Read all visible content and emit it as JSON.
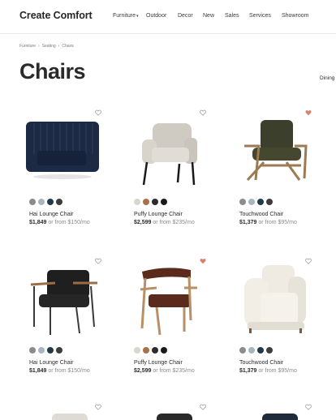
{
  "brand": "Create Comfort",
  "nav": [
    {
      "label": "Furniture",
      "has_caret": true
    },
    {
      "label": "Outdoor"
    },
    {
      "label": "Decor"
    },
    {
      "label": "New"
    },
    {
      "label": "Sales"
    },
    {
      "label": "Services"
    },
    {
      "label": "Showroom"
    }
  ],
  "breadcrumb": [
    "Furniture",
    "Seating",
    "Chairs"
  ],
  "breadcrumb_sep": "›",
  "page_title": "Chairs",
  "filter_tab": "Dining",
  "products": [
    {
      "name": "Hai Lounge Chair",
      "price": "$1,849",
      "financing": "or from $150/mo",
      "favorited": false,
      "swatches": [
        "#8b8b8b",
        "#a9b6bd",
        "#1f3a4a",
        "#3d3d3d"
      ],
      "image": "navy-velvet-swivel-chair-icon"
    },
    {
      "name": "Puffy Lounge Chair",
      "price": "$2,599",
      "financing": "or from $235/mo",
      "favorited": false,
      "swatches": [
        "#d9d6cf",
        "#a9714a",
        "#2c2c2c",
        "#1a1a1a"
      ],
      "image": "gray-boucle-lounge-chair-icon"
    },
    {
      "name": "Touchwood Chair",
      "price": "$1,379",
      "financing": "or from $95/mo",
      "favorited": true,
      "swatches": [
        "#8c8c8c",
        "#a7b5bd",
        "#1f3a4a",
        "#3d3d3d"
      ],
      "image": "olive-leather-wood-chair-icon"
    },
    {
      "name": "Hai Lounge Chair",
      "price": "$1,849",
      "financing": "or from $150/mo",
      "favorited": false,
      "swatches": [
        "#8b8b8b",
        "#a9b6bd",
        "#1f3a4a",
        "#3d3d3d"
      ],
      "image": "black-leather-iron-chair-icon"
    },
    {
      "name": "Puffy Lounge Chair",
      "price": "$2,599",
      "financing": "or from $235/mo",
      "favorited": true,
      "swatches": [
        "#d9d6cf",
        "#a9714a",
        "#2c2c2c",
        "#1a1a1a"
      ],
      "image": "brown-leather-wood-chair-icon"
    },
    {
      "name": "Touchwood Chair",
      "price": "$1,379",
      "financing": "or from $95/mo",
      "favorited": false,
      "swatches": [
        "#8c8c8c",
        "#a7b5bd",
        "#1f3a4a",
        "#3d3d3d"
      ],
      "image": "white-slipcover-chair-icon"
    }
  ],
  "colors": {
    "heart_outline": "#9a9a9a",
    "heart_filled": "#d9826e",
    "accent_text": "#2b2b2b"
  }
}
